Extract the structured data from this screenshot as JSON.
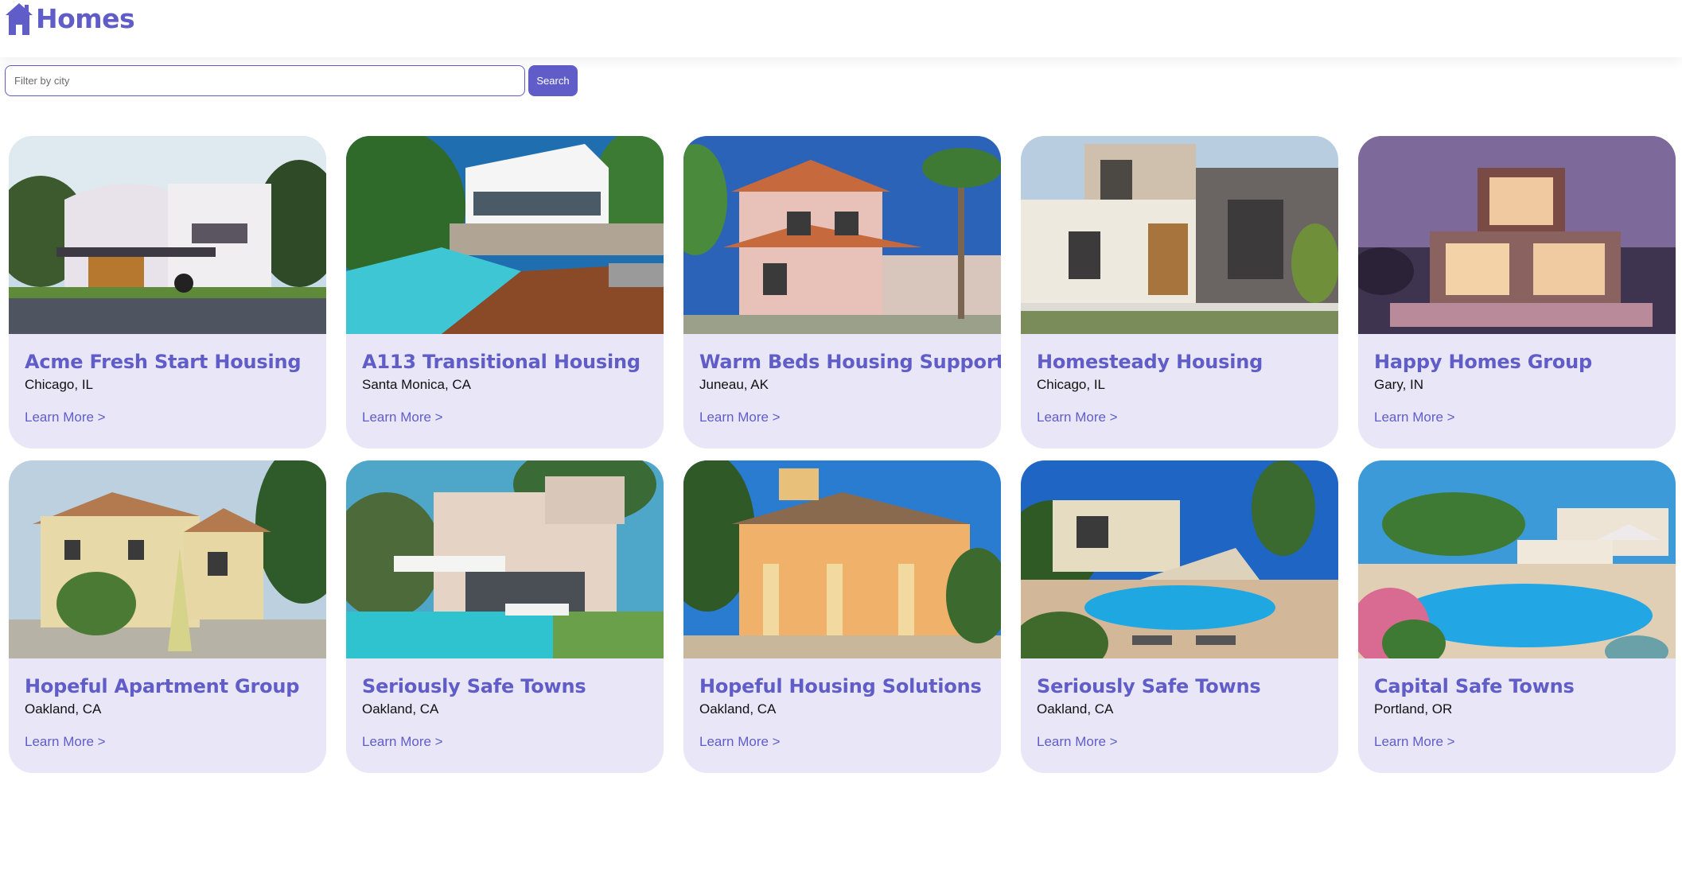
{
  "app": {
    "brand_name": "Homes",
    "accent_color": "#605dc8",
    "card_color": "#e8e6f7",
    "logo_icon": "house-icon"
  },
  "search": {
    "placeholder": "Filter by city",
    "value": "",
    "button_label": "Search"
  },
  "listings": [
    {
      "name": "Acme Fresh Start Housing",
      "location": "Chicago, IL",
      "link": "Learn More >",
      "photo": "white modern house with motorcycle"
    },
    {
      "name": "A113 Transitional Housing",
      "location": "Santa Monica, CA",
      "link": "Learn More >",
      "photo": "white villa with pool and wood deck"
    },
    {
      "name": "Warm Beds Housing Support",
      "location": "Juneau, AK",
      "link": "Learn More >",
      "photo": "pink house with palm tree"
    },
    {
      "name": "Homesteady Housing",
      "location": "Chicago, IL",
      "link": "Learn More >",
      "photo": "beige modern house with wood door"
    },
    {
      "name": "Happy Homes Group",
      "location": "Gary, IN",
      "link": "Learn More >",
      "photo": "modern house at dusk with pool"
    },
    {
      "name": "Hopeful Apartment Group",
      "location": "Oakland, CA",
      "link": "Learn More >",
      "photo": "yellow villa with umbrella"
    },
    {
      "name": "Seriously Safe Towns",
      "location": "Oakland, CA",
      "link": "Learn More >",
      "photo": "beige modern house with pool"
    },
    {
      "name": "Hopeful Housing Solutions",
      "location": "Oakland, CA",
      "link": "Learn More >",
      "photo": "orange villa with porch"
    },
    {
      "name": "Seriously Safe Towns",
      "location": "Oakland, CA",
      "link": "Learn More >",
      "photo": "villa with pool and stairs"
    },
    {
      "name": "Capital Safe Towns",
      "location": "Portland, OR",
      "link": "Learn More >",
      "photo": "resort pool with flowers"
    }
  ]
}
